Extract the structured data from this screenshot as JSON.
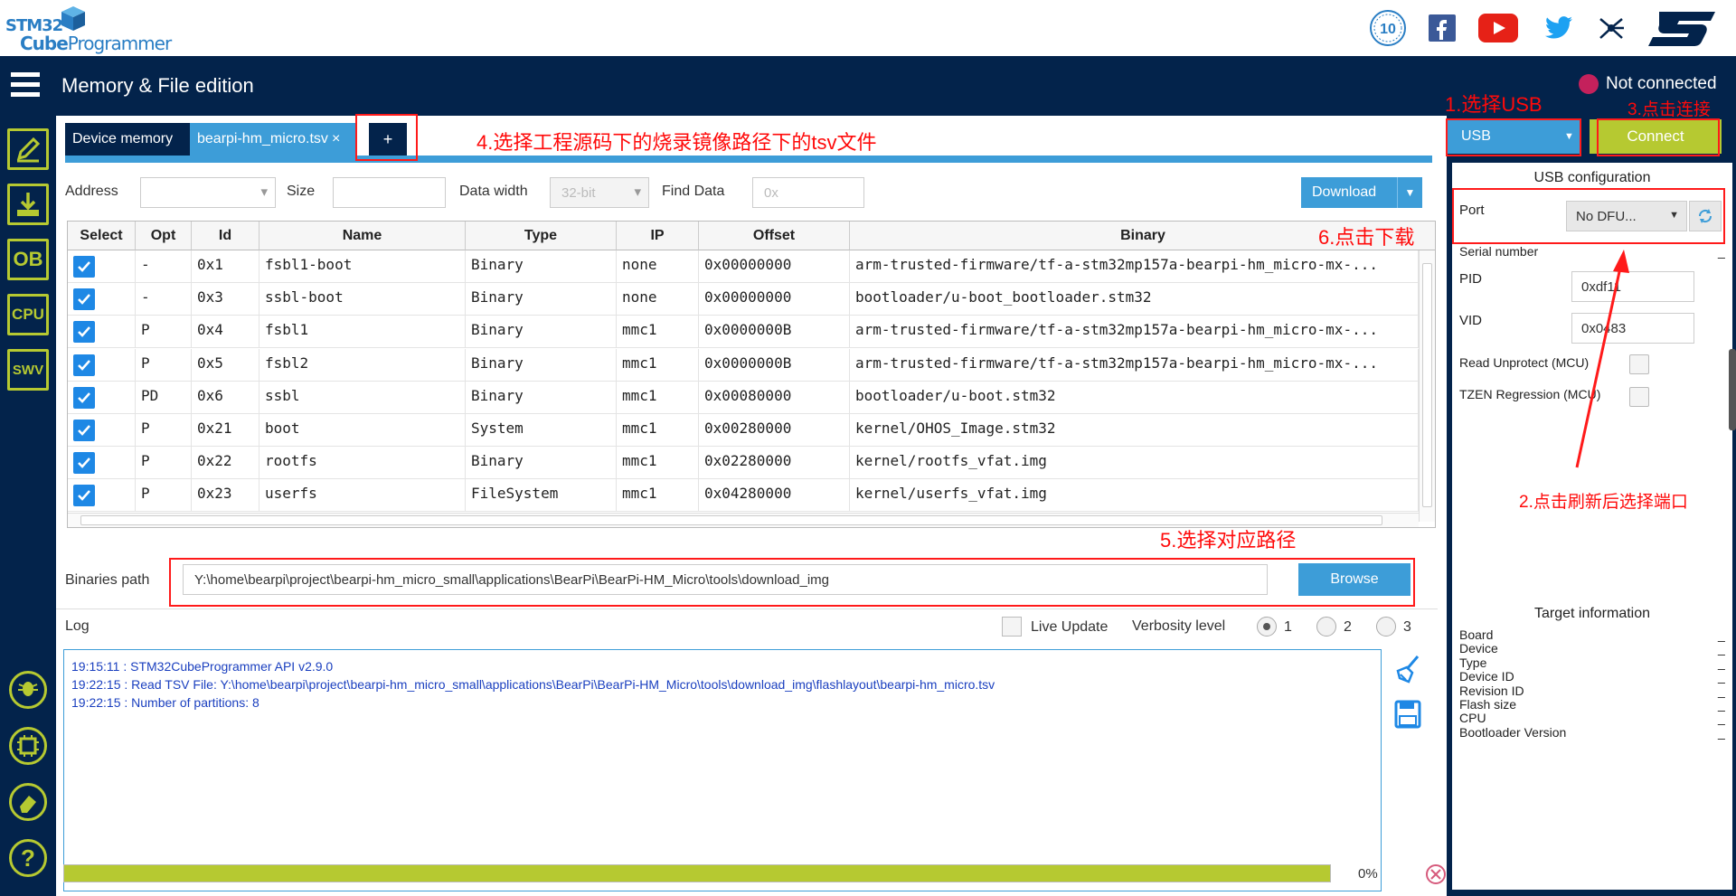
{
  "app": {
    "logo_line1": "STM32",
    "logo_line2_a": "Cube",
    "logo_line2_b": "Programmer",
    "title": "Memory & File edition",
    "connection_status": "Not connected",
    "anniversary_badge": "10"
  },
  "tabs": [
    {
      "label": "Device memory"
    },
    {
      "label": "bearpi-hm_micro.tsv"
    },
    {
      "label": "+"
    }
  ],
  "tab_close": "×",
  "toolbar": {
    "address_label": "Address",
    "size_label": "Size",
    "data_width_label": "Data width",
    "data_width_value": "32-bit",
    "find_data_label": "Find Data",
    "find_data_placeholder": "0x",
    "download_label": "Download"
  },
  "table": {
    "headers": [
      "Select",
      "Opt",
      "Id",
      "Name",
      "Type",
      "IP",
      "Offset",
      "Binary"
    ],
    "rows": [
      {
        "opt": "-",
        "id": "0x1",
        "name": "fsbl1-boot",
        "type": "Binary",
        "ip": "none",
        "offset": "0x00000000",
        "binary": "arm-trusted-firmware/tf-a-stm32mp157a-bearpi-hm_micro-mx-..."
      },
      {
        "opt": "-",
        "id": "0x3",
        "name": "ssbl-boot",
        "type": "Binary",
        "ip": "none",
        "offset": "0x00000000",
        "binary": "bootloader/u-boot_bootloader.stm32"
      },
      {
        "opt": "P",
        "id": "0x4",
        "name": "fsbl1",
        "type": "Binary",
        "ip": "mmc1",
        "offset": "0x0000000B",
        "binary": "arm-trusted-firmware/tf-a-stm32mp157a-bearpi-hm_micro-mx-..."
      },
      {
        "opt": "P",
        "id": "0x5",
        "name": "fsbl2",
        "type": "Binary",
        "ip": "mmc1",
        "offset": "0x0000000B",
        "binary": "arm-trusted-firmware/tf-a-stm32mp157a-bearpi-hm_micro-mx-..."
      },
      {
        "opt": "PD",
        "id": "0x6",
        "name": "ssbl",
        "type": "Binary",
        "ip": "mmc1",
        "offset": "0x00080000",
        "binary": "bootloader/u-boot.stm32"
      },
      {
        "opt": "P",
        "id": "0x21",
        "name": "boot",
        "type": "System",
        "ip": "mmc1",
        "offset": "0x00280000",
        "binary": "kernel/OHOS_Image.stm32"
      },
      {
        "opt": "P",
        "id": "0x22",
        "name": "rootfs",
        "type": "Binary",
        "ip": "mmc1",
        "offset": "0x02280000",
        "binary": "kernel/rootfs_vfat.img"
      },
      {
        "opt": "P",
        "id": "0x23",
        "name": "userfs",
        "type": "FileSystem",
        "ip": "mmc1",
        "offset": "0x04280000",
        "binary": "kernel/userfs_vfat.img"
      }
    ]
  },
  "binaries": {
    "label": "Binaries path",
    "path": "Y:\\home\\bearpi\\project\\bearpi-hm_micro_small\\applications\\BearPi\\BearPi-HM_Micro\\tools\\download_img",
    "browse_label": "Browse"
  },
  "log": {
    "label": "Log",
    "live_update_label": "Live Update",
    "verbosity_label": "Verbosity level",
    "verbosity_options": [
      "1",
      "2",
      "3"
    ],
    "lines": [
      "19:15:11 : STM32CubeProgrammer API v2.9.0",
      "19:22:15 : Read TSV File: Y:\\home\\bearpi\\project\\bearpi-hm_micro_small\\applications\\BearPi\\BearPi-HM_Micro\\tools\\download_img\\flashlayout\\bearpi-hm_micro.tsv",
      "19:22:15 : Number of partitions: 8"
    ]
  },
  "progress": {
    "value": 1.0,
    "label": "0%"
  },
  "right_panel": {
    "interface_value": "USB",
    "connect_label": "Connect",
    "usb_config_title": "USB configuration",
    "port_label": "Port",
    "port_value": "No DFU...",
    "serial_label": "Serial number",
    "serial_value": "_",
    "pid_label": "PID",
    "pid_value": "0xdf11",
    "vid_label": "VID",
    "vid_value": "0x0483",
    "read_unprotect_label": "Read Unprotect (MCU)",
    "tzen_label": "TZEN Regression (MCU)",
    "target_title": "Target information",
    "target_fields": [
      {
        "label": "Board",
        "value": "_"
      },
      {
        "label": "Device",
        "value": "_"
      },
      {
        "label": "Type",
        "value": "_"
      },
      {
        "label": "Device ID",
        "value": "_"
      },
      {
        "label": "Revision ID",
        "value": "_"
      },
      {
        "label": "Flash size",
        "value": "_"
      },
      {
        "label": "CPU",
        "value": "_"
      },
      {
        "label": "Bootloader Version",
        "value": "_"
      }
    ]
  },
  "sidebar": {
    "ob_label": "OB",
    "cpu_label": "CPU",
    "swv_label": "SWV",
    "help_label": "?"
  },
  "annotations": {
    "a1": "1.选择USB",
    "a2": "2.点击刷新后选择端口",
    "a3": "3.点击连接",
    "a4": "4.选择工程源码下的烧录镜像路径下的tsv文件",
    "a5": "5.选择对应路径",
    "a6": "6.点击下载"
  },
  "colors": {
    "accent": "#3d9dd8",
    "navy": "#03234b",
    "lime": "#b6c931",
    "annotation": "#ff0a0a"
  }
}
